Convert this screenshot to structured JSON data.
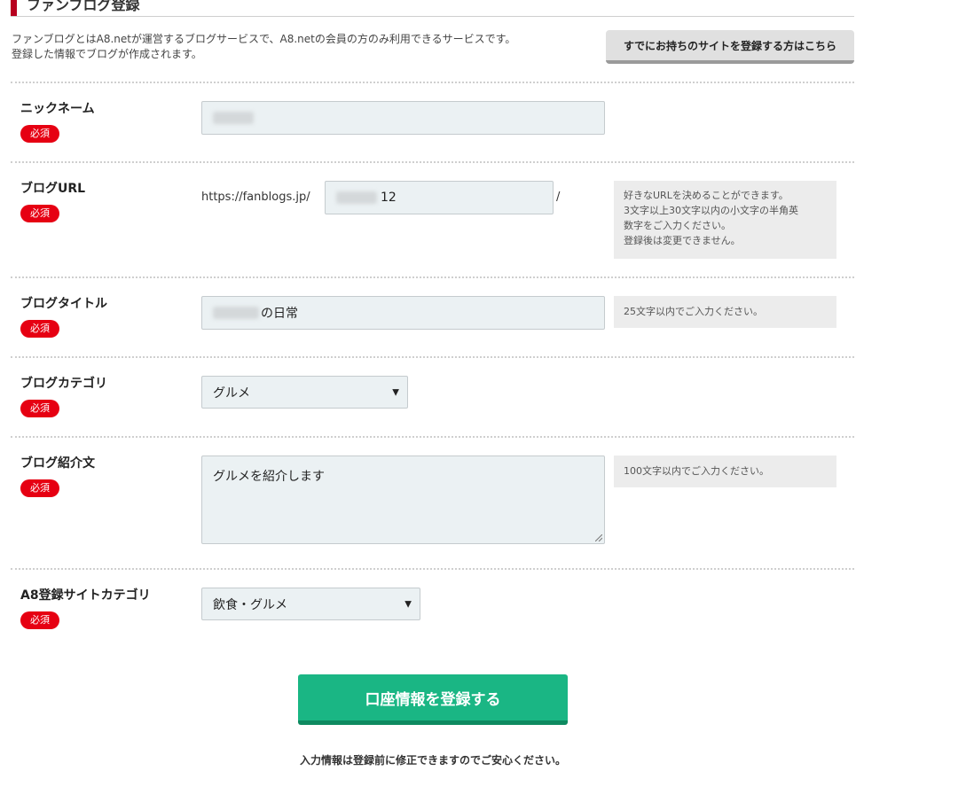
{
  "header": {
    "title": "ファンブログ登録"
  },
  "intro": {
    "line1": "ファンブログとはA8.netが運営するブログサービスで、A8.netの会員の方のみ利用できるサービスです。",
    "line2": "登録した情報でブログが作成されます。"
  },
  "existing_site_button": "すでにお持ちのサイトを登録する方はこちら",
  "required_badge": "必須",
  "fields": {
    "nickname": {
      "label": "ニックネーム"
    },
    "blog_url": {
      "label": "ブログURL",
      "prefix": "https://fanblogs.jp/",
      "value": "12",
      "suffix": "/",
      "hint_lines": [
        "好きなURLを決めることができます。",
        "3文字以上30文字以内の小文字の半角英",
        "数字をご入力ください。",
        "登録後は変更できません。"
      ]
    },
    "blog_title": {
      "label": "ブログタイトル",
      "value_suffix": "の日常",
      "hint": "25文字以内でご入力ください。"
    },
    "blog_category": {
      "label": "ブログカテゴリ",
      "selected": "グルメ"
    },
    "blog_intro": {
      "label": "ブログ紹介文",
      "value": "グルメを紹介します",
      "hint": "100文字以内でご入力ください。"
    },
    "a8_site_category": {
      "label": "A8登録サイトカテゴリ",
      "selected": "飲食・グルメ"
    }
  },
  "submit_button": "口座情報を登録する",
  "footnote": "入力情報は登録前に修正できますのでご安心ください。",
  "colors": {
    "accent_red": "#e60012",
    "title_accent": "#b8001f",
    "submit_green": "#1ab684",
    "input_bg": "#ebf1f3"
  }
}
